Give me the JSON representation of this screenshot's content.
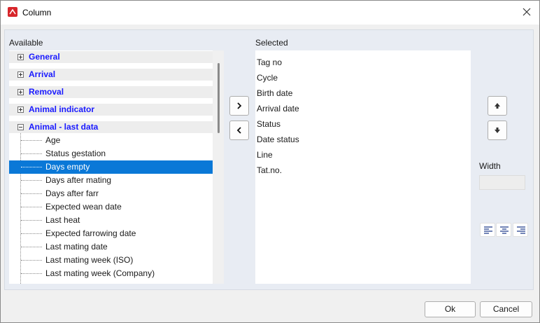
{
  "window": {
    "title": "Column"
  },
  "available": {
    "label": "Available",
    "groups": [
      {
        "label": "General",
        "expanded": false
      },
      {
        "label": "Arrival",
        "expanded": false
      },
      {
        "label": "Removal",
        "expanded": false
      },
      {
        "label": "Animal indicator",
        "expanded": false
      },
      {
        "label": "Animal - last data",
        "expanded": true
      }
    ],
    "items": [
      {
        "label": "Age",
        "selected": false
      },
      {
        "label": "Status gestation",
        "selected": false
      },
      {
        "label": "Days empty",
        "selected": true
      },
      {
        "label": "Days after mating",
        "selected": false
      },
      {
        "label": "Days after farr",
        "selected": false
      },
      {
        "label": "Expected wean date",
        "selected": false
      },
      {
        "label": "Last heat",
        "selected": false
      },
      {
        "label": "Expected farrowing date",
        "selected": false
      },
      {
        "label": "Last mating date",
        "selected": false
      },
      {
        "label": "Last mating week (ISO)",
        "selected": false
      },
      {
        "label": "Last mating week (Company)",
        "selected": false
      }
    ]
  },
  "selected": {
    "label": "Selected",
    "items": [
      "Tag no",
      "Cycle",
      "Birth date",
      "Arrival date",
      "Status",
      "Date status",
      "Line",
      "Tat.no."
    ]
  },
  "width": {
    "label": "Width",
    "value": ""
  },
  "buttons": {
    "ok": "Ok",
    "cancel": "Cancel"
  },
  "colors": {
    "selection": "#0a78d7",
    "group_text": "#1a1aff",
    "app_icon": "#d7262b"
  }
}
